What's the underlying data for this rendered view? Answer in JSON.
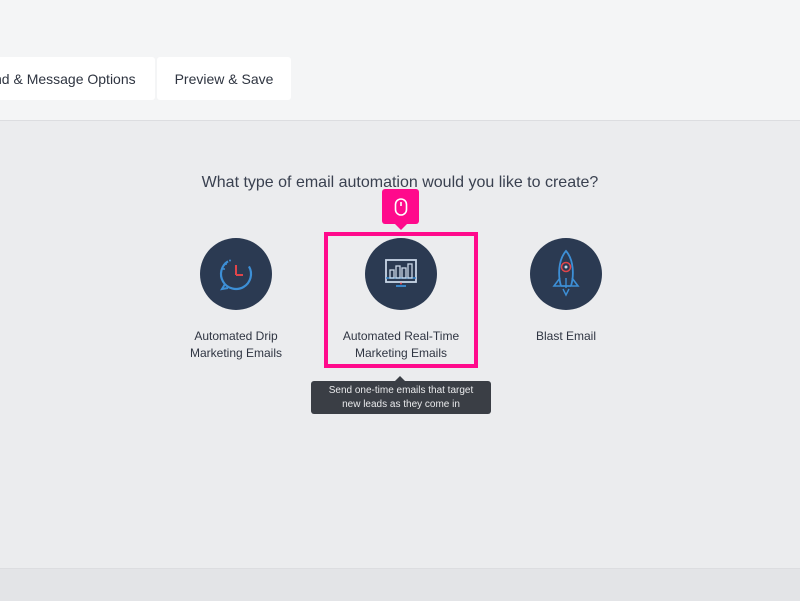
{
  "header": {
    "tabs": [
      {
        "label": "nd & Message Options"
      },
      {
        "label": "Preview & Save"
      }
    ]
  },
  "main": {
    "question": "What type of email automation would you like to create?",
    "options": [
      {
        "label_line1": "Automated Drip",
        "label_line2": "Marketing Emails",
        "icon": "clock-refresh-icon"
      },
      {
        "label_line1": "Automated Real-Time",
        "label_line2": "Marketing Emails",
        "icon": "monitor-chart-icon"
      },
      {
        "label_line1": "Blast Email",
        "label_line2": "",
        "icon": "rocket-icon"
      }
    ],
    "tooltip": {
      "line1": "Send one-time emails that target",
      "line2": "new leads as they come in"
    }
  },
  "colors": {
    "highlight": "#ff0a8c",
    "icon_circle": "#2b3a52",
    "icon_accent": "#3d8fd6",
    "icon_red": "#e0454a"
  }
}
